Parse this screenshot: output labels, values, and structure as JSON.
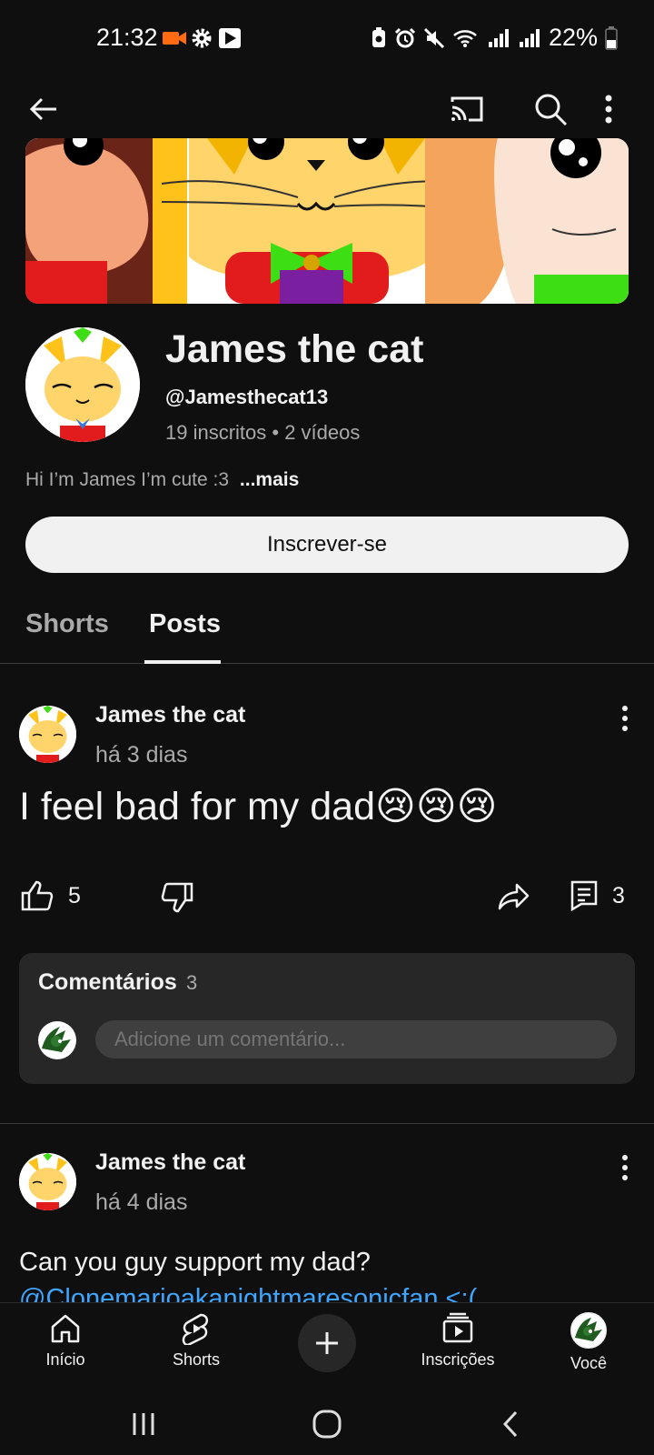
{
  "status_bar": {
    "time": "21:32",
    "battery": "22%",
    "left_icons": [
      "video-record-icon",
      "gear-icon",
      "play-store-icon"
    ],
    "right_icons": [
      "battery-saver-icon",
      "alarm-icon",
      "mute-icon",
      "wifi-icon",
      "signal-icon",
      "signal-icon",
      "battery-icon"
    ]
  },
  "app_bar": {
    "icons": [
      "back-arrow-icon",
      "cast-icon",
      "search-icon",
      "more-vert-icon"
    ]
  },
  "channel": {
    "name": "James the cat",
    "handle": "@Jamesthecat13",
    "stats": "19 inscritos • 2 vídeos",
    "description": "Hi I’m James I’m cute :3",
    "more_label": "...mais",
    "subscribe_label": "Inscrever-se"
  },
  "tabs": [
    {
      "label": "Shorts",
      "selected": false
    },
    {
      "label": "Posts",
      "selected": true
    }
  ],
  "posts": [
    {
      "author": "James the cat",
      "time": "há 3 dias",
      "text": "I feel bad for my dad😢😢😢",
      "likes": "5",
      "comments": "3"
    },
    {
      "author": "James the cat",
      "time": "há 4 dias",
      "text": "Can you guy support my dad?",
      "mention": "@Clonemarioakanightmaresonicfan <:("
    }
  ],
  "comments_section": {
    "title": "Comentários",
    "count": "3",
    "placeholder": "Adicione um comentário..."
  },
  "bottom_nav": [
    {
      "label": "Início",
      "icon": "home-icon"
    },
    {
      "label": "Shorts",
      "icon": "shorts-icon"
    },
    {
      "label": "",
      "icon": "plus-icon"
    },
    {
      "label": "Inscrições",
      "icon": "subscriptions-icon"
    },
    {
      "label": "Você",
      "icon": "avatar-icon"
    }
  ],
  "system_nav": [
    "recent-apps-icon",
    "home-circle-icon",
    "back-chevron-icon"
  ],
  "colors": {
    "background": "#0f0f0f",
    "text": "#f1f1f1",
    "secondary_text": "#aaaaaa",
    "link": "#3ea6ff",
    "card": "#272727"
  }
}
